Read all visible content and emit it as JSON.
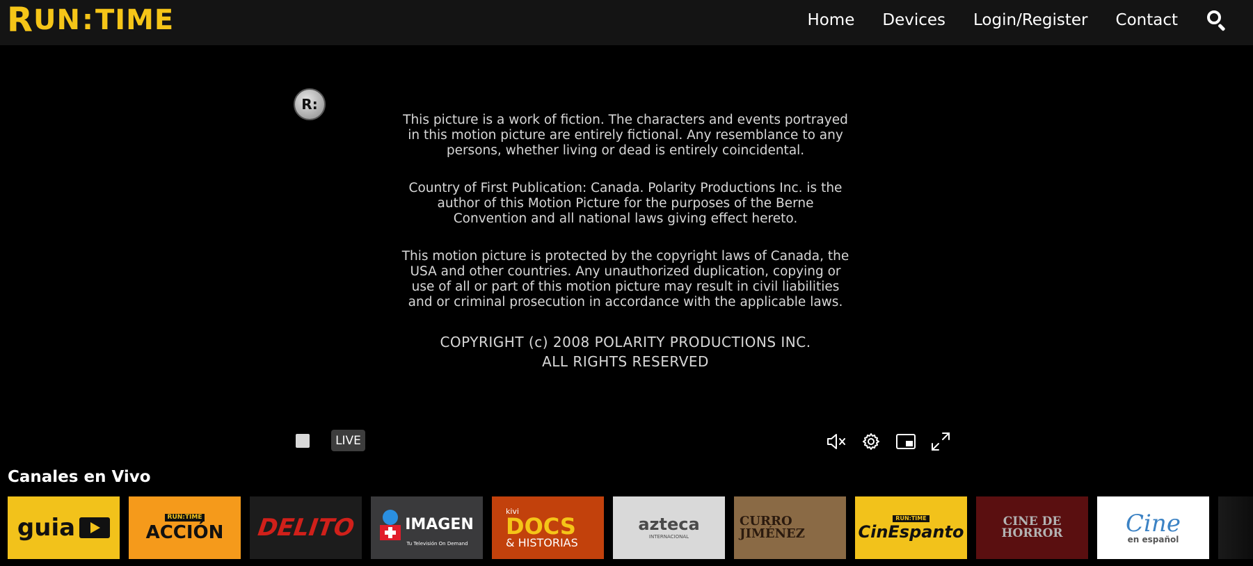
{
  "header": {
    "logo": {
      "r": "R",
      "un": "UN",
      "colon": ":",
      "time": "TIME"
    },
    "nav": [
      "Home",
      "Devices",
      "Login/Register",
      "Contact"
    ],
    "search_icon": "search-icon"
  },
  "player": {
    "watermark": "R:",
    "credits": [
      "This picture is a work of fiction.  The characters and events portrayed in this motion picture are entirely fictional.  Any resemblance to any persons, whether living or dead is entirely coincidental.",
      "Country of First Publication: Canada.  Polarity Productions Inc. is the author of this Motion Picture for the purposes of the Berne Convention and all national laws giving effect hereto.",
      "This motion picture is protected by the copyright laws of Canada, the USA and other countries.  Any unauthorized duplication, copying or use of all or part of this motion picture may result in civil liabilities and or criminal prosecution in accordance with the applicable laws."
    ],
    "copyright_line1": "COPYRIGHT (c) 2008 POLARITY PRODUCTIONS INC.",
    "copyright_line2": "ALL RIGHTS RESERVED",
    "controls": {
      "live_label": "LIVE",
      "icons": [
        "stop-icon",
        "mute-icon",
        "settings-icon",
        "picture-in-picture-icon",
        "fullscreen-icon"
      ]
    }
  },
  "channels": {
    "title": "Canales en Vivo",
    "items": [
      {
        "label": "guia",
        "sub": "",
        "bg": "#f2c21b",
        "fg": "#111111"
      },
      {
        "label": "ACCIÓN",
        "sub": "RUN:TIME",
        "bg": "#f59a1b",
        "fg": "#111111"
      },
      {
        "label": "DELITO",
        "sub": "",
        "bg": "#1c1c1c",
        "fg": "#d0201a"
      },
      {
        "label": "IMAGEN",
        "sub": "Tu Televisión On Demand",
        "bg": "#3a3a3c",
        "fg": "#ffffff"
      },
      {
        "label": "DOCS",
        "sub": "& HISTORIAS",
        "bg": "#c2410c",
        "fg": "#f5c518",
        "top": "kivi"
      },
      {
        "label": "azteca",
        "sub": "INTERNACIONAL",
        "bg": "#d9d9d9",
        "fg": "#4a4a4a"
      },
      {
        "label": "CURRO JIMÉNEZ",
        "sub": "",
        "bg": "#8a6a45",
        "fg": "#2b1a0e"
      },
      {
        "label": "CinEspanto",
        "sub": "RUN:TIME",
        "bg": "#f2c21b",
        "fg": "#111111"
      },
      {
        "label": "CINE DE HORROR",
        "sub": "",
        "bg": "#5a0f10",
        "fg": "#b3b3b3"
      },
      {
        "label": "Cine",
        "sub": "en español",
        "bg": "#ffffff",
        "fg": "#3b82c4"
      }
    ]
  },
  "colors": {
    "brand": "#f5c518",
    "header_bg": "#141414",
    "page_bg": "#000000"
  }
}
